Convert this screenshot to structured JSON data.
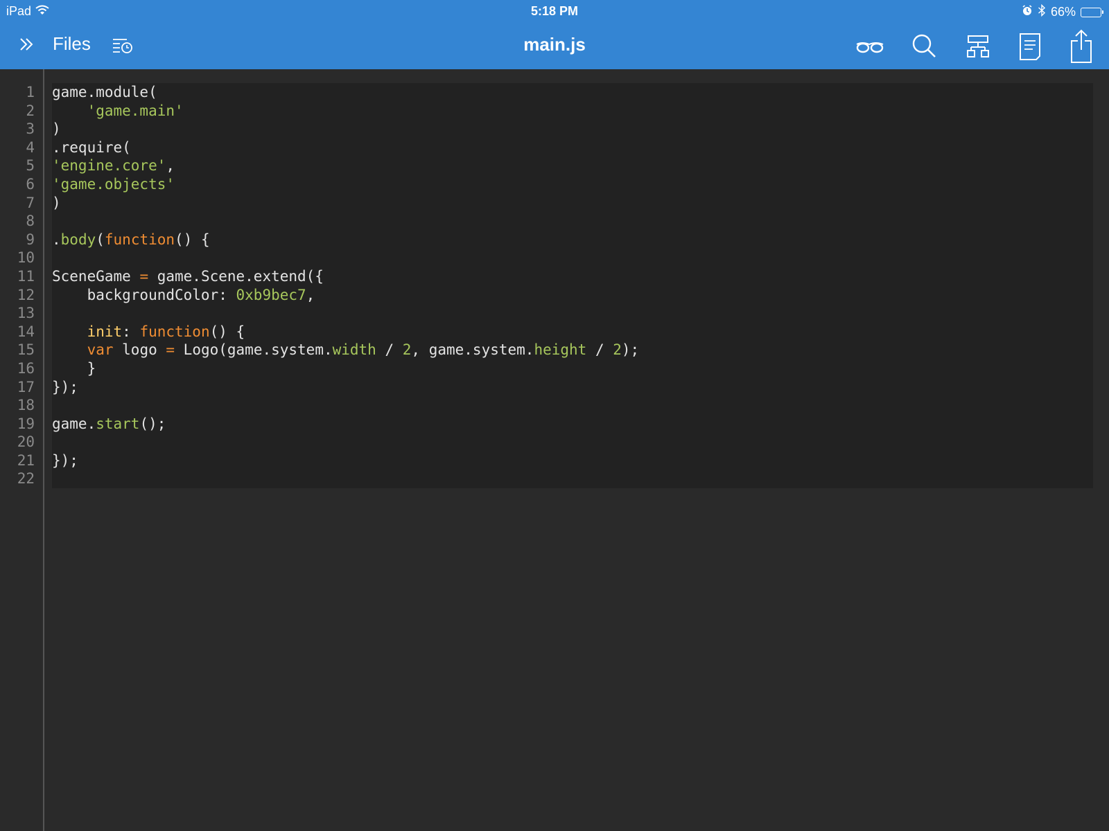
{
  "status_bar": {
    "device": "iPad",
    "time": "5:18 PM",
    "battery_percent": "66%",
    "battery_level": 0.66
  },
  "nav": {
    "files_label": "Files",
    "title": "main.js",
    "icons": [
      "sidebar-toggle-icon",
      "recent-files-icon",
      "glasses-icon",
      "search-icon",
      "structure-icon",
      "document-icon",
      "share-icon"
    ]
  },
  "colors": {
    "header": "#3485d3",
    "editor_bg": "#2a2a2a",
    "code_bg": "#222222",
    "text": "#e4e4e4",
    "string": "#a7c75c",
    "keyword": "#f08d33",
    "property": "#ffcf6b",
    "line_number": "#8a8a8a"
  },
  "editor": {
    "line_numbers": [
      "1",
      "2",
      "3",
      "4",
      "5",
      "6",
      "7",
      "8",
      "9",
      "10",
      "11",
      "12",
      "13",
      "14",
      "15",
      "16",
      "17",
      "18",
      "19",
      "20",
      "21",
      "22"
    ],
    "lines": [
      [
        {
          "t": "game.module("
        }
      ],
      [
        {
          "t": "    "
        },
        {
          "t": "'game.main'",
          "c": "str"
        }
      ],
      [
        {
          "t": ")"
        }
      ],
      [
        {
          "t": ".require("
        }
      ],
      [
        {
          "t": "'engine.core'",
          "c": "str"
        },
        {
          "t": ","
        }
      ],
      [
        {
          "t": "'game.objects'",
          "c": "str"
        }
      ],
      [
        {
          "t": ")"
        }
      ],
      [],
      [
        {
          "t": "."
        },
        {
          "t": "body",
          "c": "fn"
        },
        {
          "t": "("
        },
        {
          "t": "function",
          "c": "kw"
        },
        {
          "t": "() {"
        }
      ],
      [],
      [
        {
          "t": "SceneGame "
        },
        {
          "t": "=",
          "c": "op"
        },
        {
          "t": " game.Scene.extend({"
        }
      ],
      [
        {
          "t": "    backgroundColor: "
        },
        {
          "t": "0xb9bec7",
          "c": "num"
        },
        {
          "t": ","
        }
      ],
      [],
      [
        {
          "t": "    "
        },
        {
          "t": "init",
          "c": "prop"
        },
        {
          "t": ": "
        },
        {
          "t": "function",
          "c": "kw"
        },
        {
          "t": "() {"
        }
      ],
      [
        {
          "t": "    "
        },
        {
          "t": "var",
          "c": "kw"
        },
        {
          "t": " logo "
        },
        {
          "t": "=",
          "c": "op"
        },
        {
          "t": " Logo(game.system."
        },
        {
          "t": "width",
          "c": "fn"
        },
        {
          "t": " / "
        },
        {
          "t": "2",
          "c": "num"
        },
        {
          "t": ", game.system."
        },
        {
          "t": "height",
          "c": "fn"
        },
        {
          "t": " / "
        },
        {
          "t": "2",
          "c": "num"
        },
        {
          "t": ");"
        }
      ],
      [
        {
          "t": "    }"
        }
      ],
      [
        {
          "t": "});"
        }
      ],
      [],
      [
        {
          "t": "game."
        },
        {
          "t": "start",
          "c": "fn"
        },
        {
          "t": "();"
        }
      ],
      [],
      [
        {
          "t": "});"
        }
      ],
      []
    ]
  }
}
